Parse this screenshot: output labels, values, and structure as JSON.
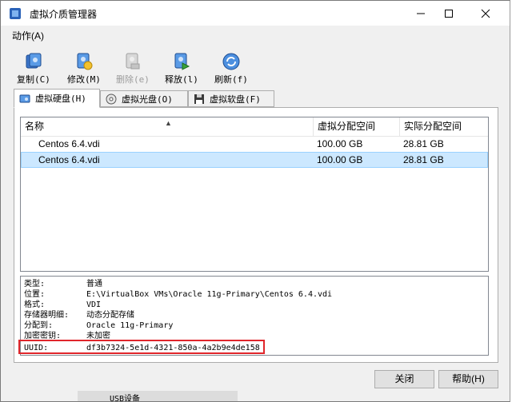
{
  "window": {
    "title": "虚拟介质管理器"
  },
  "menubar": {
    "action": "动作(A)"
  },
  "toolbar": {
    "copy": "复制(C)",
    "modify": "修改(M)",
    "delete": "删除(e)",
    "release": "释放(l)",
    "refresh": "刷新(f)"
  },
  "tabs": {
    "hdd": "虚拟硬盘(H)",
    "optical": "虚拟光盘(O)",
    "floppy": "虚拟软盘(F)"
  },
  "list": {
    "columns": {
      "name": "名称",
      "virtual_size": "虚拟分配空间",
      "actual_size": "实际分配空间"
    },
    "rows": [
      {
        "name": "Centos 6.4.vdi",
        "virtual_size": "100.00 GB",
        "actual_size": "28.81 GB"
      },
      {
        "name": "Centos 6.4.vdi",
        "virtual_size": "100.00 GB",
        "actual_size": "28.81 GB"
      }
    ]
  },
  "details": {
    "type": {
      "label": "类型:",
      "value": "普通"
    },
    "location": {
      "label": "位置:",
      "value": "E:\\VirtualBox VMs\\Oracle 11g-Primary\\Centos 6.4.vdi"
    },
    "format": {
      "label": "格式:",
      "value": "VDI"
    },
    "storage": {
      "label": "存储器明细:",
      "value": "动态分配存储"
    },
    "attached": {
      "label": "分配到:",
      "value": "Oracle 11g-Primary"
    },
    "encryption": {
      "label": "加密密钥:",
      "value": "未加密"
    },
    "uuid": {
      "label": "UUID:",
      "value": "df3b7324-5e1d-4321-850a-4a2b9e4de158"
    }
  },
  "buttons": {
    "close": "关闭",
    "help": "帮助(H)"
  },
  "background": {
    "partial_text": "USB设备"
  },
  "colors": {
    "selection": "#cce8ff",
    "highlight_box": "#e0262b"
  }
}
